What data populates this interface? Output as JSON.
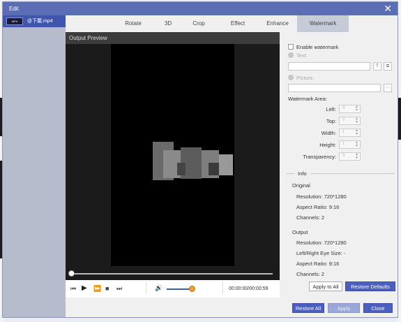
{
  "window": {
    "title": "Edit",
    "close_glyph": "✕"
  },
  "file_list": {
    "items": [
      {
        "thumb_text": "MP4",
        "name": "@下載.mp4"
      }
    ]
  },
  "tabs": [
    {
      "label": "Rotate"
    },
    {
      "label": "3D"
    },
    {
      "label": "Crop"
    },
    {
      "label": "Effect"
    },
    {
      "label": "Enhance"
    },
    {
      "label": "Watermark",
      "active": true
    }
  ],
  "preview": {
    "header": "Output Preview",
    "timecode": "00:00:00/00:00:59",
    "progress_fraction": 0,
    "volume_fraction": 0.9
  },
  "watermark": {
    "enable_label": "Enable watermark",
    "text_label": "Text:",
    "text_value": "",
    "text_button": "T",
    "text_button2": "⧉",
    "picture_label": "Picture:",
    "picture_value": "",
    "picture_button": "···",
    "area_label": "Watermark Area:",
    "fields": [
      {
        "label": "Left:",
        "value": "0"
      },
      {
        "label": "Top:",
        "value": "0"
      },
      {
        "label": "Width:",
        "value": "1"
      },
      {
        "label": "Height:",
        "value": "1"
      },
      {
        "label": "Transparency:",
        "value": "0"
      }
    ]
  },
  "info": {
    "title": "Info",
    "original_title": "Original",
    "original": [
      "Resolution: 720*1280",
      "Aspect Ratio: 9:16",
      "Channels: 2"
    ],
    "output_title": "Output",
    "output": [
      "Resolution: 720*1280",
      "Left/Right Eye Size: -",
      "Aspect Ratio: 9:16",
      "Channels: 2"
    ]
  },
  "buttons": {
    "apply_to_all": "Apply to All",
    "restore_defaults": "Restore Defaults",
    "restore_all": "Restore All",
    "apply": "Apply",
    "close": "Close"
  },
  "colors": {
    "accent": "#4a5fbe",
    "titlebar": "#5b6db5",
    "sidebar": "#b6bccc"
  }
}
